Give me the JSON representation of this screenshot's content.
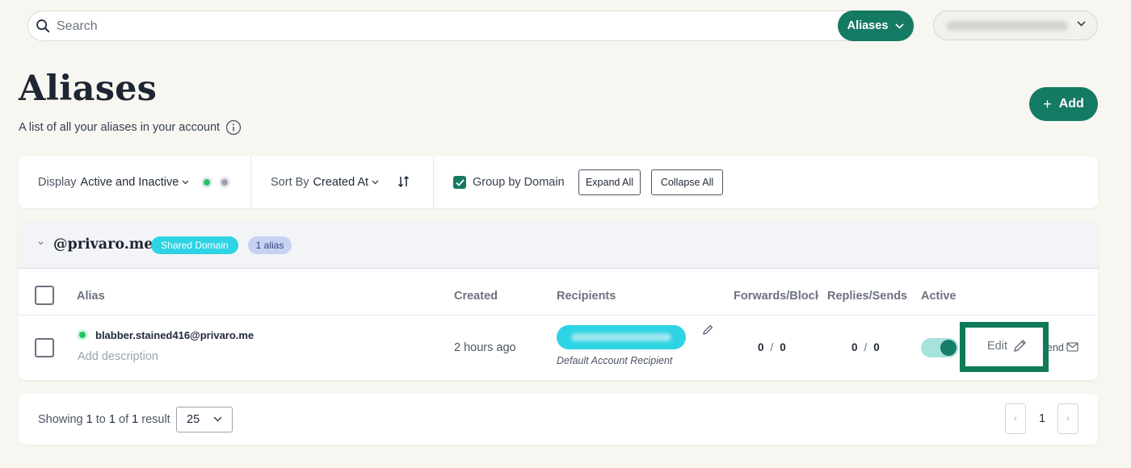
{
  "search": {
    "placeholder": "Search",
    "scope_label": "Aliases"
  },
  "header": {
    "title": "Aliases",
    "subtitle": "A list of all your aliases in your account",
    "add_label": "Add"
  },
  "filters": {
    "display_prefix": "Display",
    "display_value": "Active and Inactive",
    "sort_prefix": "Sort By",
    "sort_value": "Created At",
    "group_label": "Group by Domain",
    "group_checked": true,
    "expand_label": "Expand All",
    "collapse_label": "Collapse All"
  },
  "domain": {
    "name": "@privaro.me",
    "type_badge": "Shared Domain",
    "count_badge": "1 alias",
    "columns": [
      "Alias",
      "Created",
      "Recipients",
      "Forwards/Block",
      "Replies/Sends",
      "Active"
    ],
    "rows": [
      {
        "email": "blabber.stained416@privaro.me",
        "description_placeholder": "Add description",
        "created": "2 hours ago",
        "recipient_note": "Default Account Recipient",
        "forwards": "0",
        "blocked": "0",
        "replies": "0",
        "sends": "0",
        "active": true,
        "edit_label": "Edit",
        "send_partial": "end"
      }
    ]
  },
  "pagination": {
    "showing": "Showing",
    "from": "1",
    "to_word": "to",
    "to": "1",
    "of_word": "of",
    "total": "1",
    "result_word": "result",
    "per_page": "25",
    "current_page": "1",
    "prev_symbol": "‹",
    "next_symbol": "›"
  },
  "colors": {
    "brand": "#157a63",
    "cyan": "#2ed3e4",
    "highlight": "#0f7a5a"
  },
  "icons": [
    "search-icon",
    "chevron-down-icon",
    "info-icon",
    "plus-icon",
    "sort-icon",
    "check-icon",
    "pencil-icon",
    "mail-icon"
  ]
}
